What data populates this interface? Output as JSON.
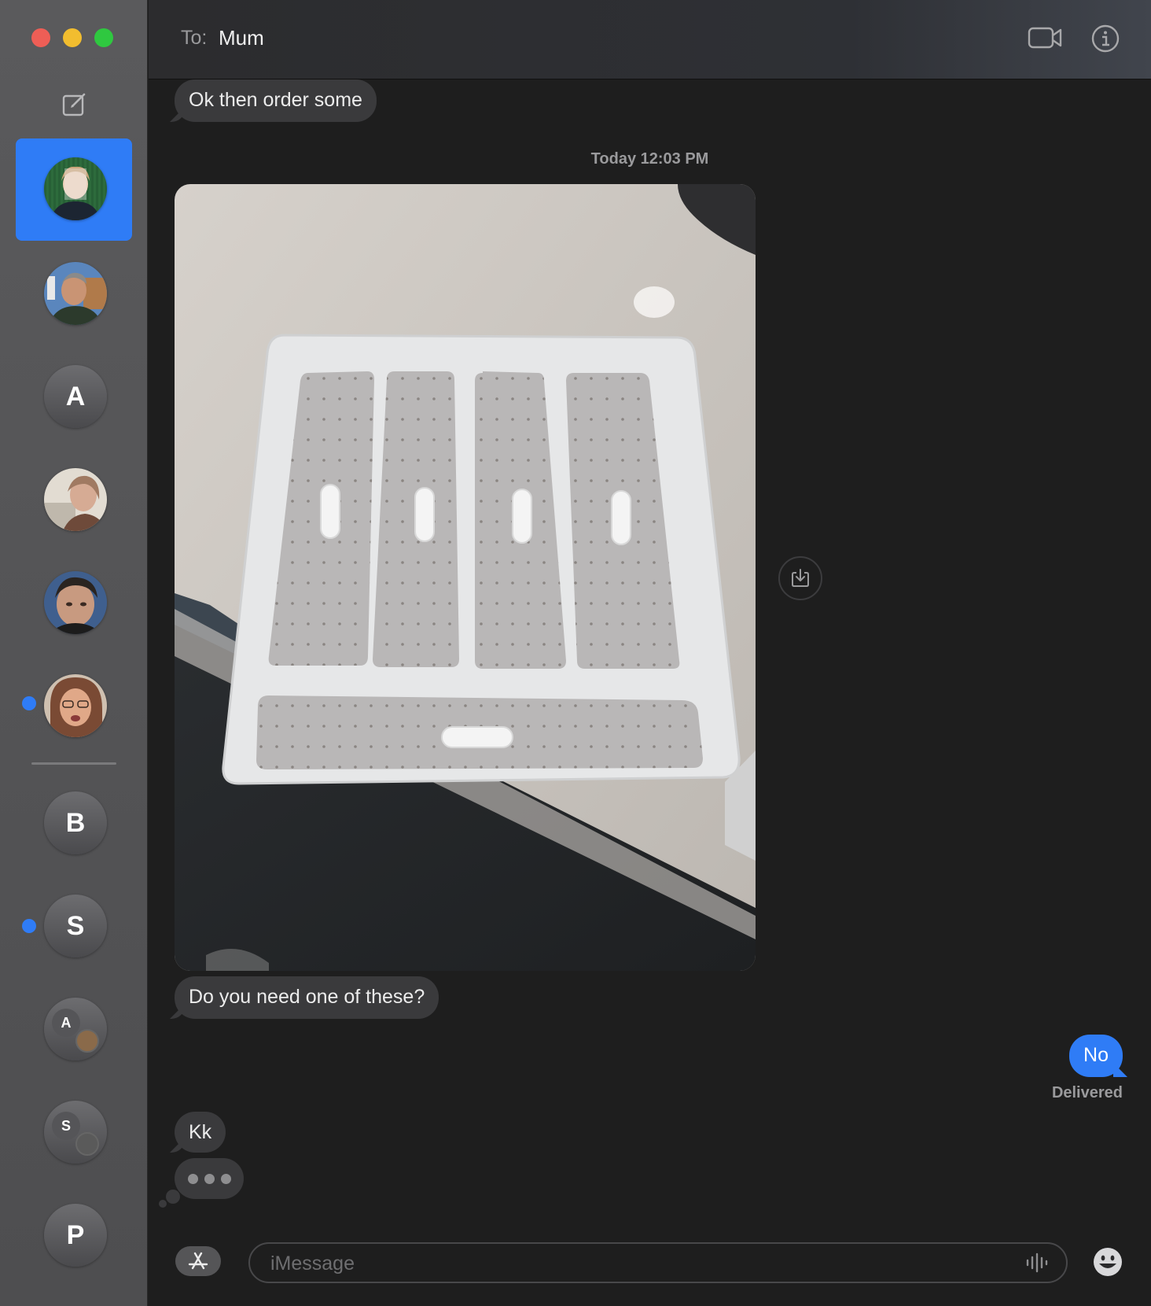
{
  "window": {
    "traffic_lights": [
      "close",
      "minimize",
      "zoom"
    ]
  },
  "sidebar": {
    "compose_icon": "compose-icon",
    "conversations": [
      {
        "type": "photo",
        "selected": true,
        "unread": false,
        "colors": [
          "#2d6b3c",
          "#f0d8c4",
          "#1c2532"
        ]
      },
      {
        "type": "photo",
        "selected": false,
        "unread": false,
        "colors": [
          "#4a7bb3",
          "#8b6a4a",
          "#2a3b2a"
        ]
      },
      {
        "type": "letter",
        "letter": "A",
        "unread": false
      },
      {
        "type": "photo",
        "selected": false,
        "unread": false,
        "colors": [
          "#d9d2c8",
          "#b58a72",
          "#6e4a3a"
        ]
      },
      {
        "type": "photo",
        "selected": false,
        "unread": false,
        "colors": [
          "#3a5a8a",
          "#c69a82",
          "#222"
        ]
      },
      {
        "type": "photo",
        "selected": false,
        "unread": true,
        "colors": [
          "#c88a6a",
          "#7a4a3a",
          "#d8c8b8"
        ]
      },
      {
        "type": "letter",
        "letter": "B",
        "unread": false
      },
      {
        "type": "letter",
        "letter": "S",
        "unread": true
      },
      {
        "type": "group",
        "letter": "A",
        "unread": false
      },
      {
        "type": "group",
        "letter": "S",
        "unread": false
      },
      {
        "type": "letter",
        "letter": "P",
        "unread": false
      }
    ]
  },
  "header": {
    "to_label": "To:",
    "recipient": "Mum",
    "video_icon": "video-camera-icon",
    "info_icon": "info-icon"
  },
  "messages": {
    "msg1": "Ok then order some",
    "timestamp": "Today 12:03 PM",
    "msg2": "Do you need one of these?",
    "reply": "No",
    "delivered": "Delivered",
    "msg3": "Kk"
  },
  "composer": {
    "apps_icon": "app-store-icon",
    "placeholder": "iMessage",
    "audio_icon": "waveform-icon",
    "emoji_icon": "emoji-icon"
  },
  "colors": {
    "accent": "#2f7cf6",
    "incoming_bubble": "#3a3a3c",
    "background": "#1e1e1e"
  }
}
